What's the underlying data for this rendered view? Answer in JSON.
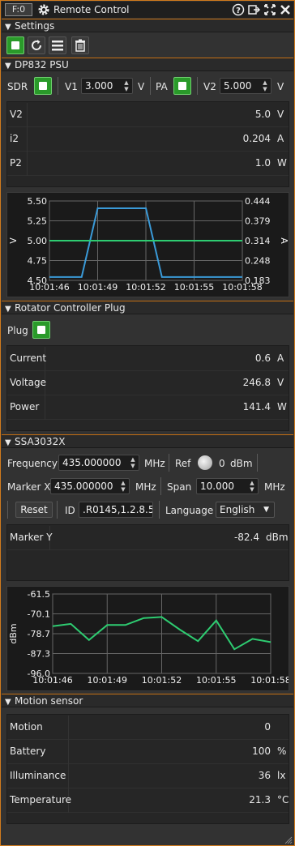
{
  "titlebar": {
    "badge": "F:0",
    "title": "Remote Control"
  },
  "settings": {
    "title": "Settings"
  },
  "dp832": {
    "title": "DP832 PSU",
    "sdr_label": "SDR",
    "v1_label": "V1",
    "v1_value": "3.000",
    "v1_unit": "V",
    "pa_label": "PA",
    "v2_label": "V2",
    "v2_value": "5.000",
    "v2_unit": "V",
    "rows": [
      {
        "name": "V2",
        "value": "5.0",
        "unit": "V"
      },
      {
        "name": "i2",
        "value": "0.204",
        "unit": "A"
      },
      {
        "name": "P2",
        "value": "1.0",
        "unit": "W"
      }
    ]
  },
  "rotator": {
    "title": "Rotator Controller Plug",
    "plug_label": "Plug",
    "rows": [
      {
        "name": "Current",
        "value": "0.6",
        "unit": "A"
      },
      {
        "name": "Voltage",
        "value": "246.8",
        "unit": "V"
      },
      {
        "name": "Power",
        "value": "141.4",
        "unit": "W"
      }
    ]
  },
  "ssa": {
    "title": "SSA3032X",
    "frequency_label": "Frequency",
    "frequency_value": "435.000000",
    "frequency_unit": "MHz",
    "ref_label": "Ref",
    "ref_value": "0",
    "ref_unit": "dBm",
    "markerx_label": "Marker X",
    "markerx_value": "435.000000",
    "markerx_unit": "MHz",
    "span_label": "Span",
    "span_value": "10.000",
    "span_unit": "MHz",
    "reset_label": "Reset",
    "id_label": "ID",
    "id_value": ".R0145,1.2.8.5a",
    "language_label": "Language",
    "language_value": "English",
    "rows": [
      {
        "name": "Marker Y",
        "value": "-82.4",
        "unit": "dBm"
      }
    ]
  },
  "motion": {
    "title": "Motion sensor",
    "rows": [
      {
        "name": "Motion",
        "value": "0",
        "unit": ""
      },
      {
        "name": "Battery",
        "value": "100",
        "unit": "%"
      },
      {
        "name": "Illuminance",
        "value": "36",
        "unit": "lx"
      },
      {
        "name": "Temperature",
        "value": "21.3",
        "unit": "°C"
      }
    ]
  },
  "colors": {
    "accent": "#d07a1c",
    "green_button": "#2a9a2a",
    "series_blue": "#3a9ad8",
    "series_green": "#2ecc71"
  },
  "chart_data": [
    {
      "type": "line",
      "title": "",
      "ylabel": "V",
      "y2label": "A",
      "ylim": [
        4.5,
        5.5
      ],
      "y2lim": [
        0.183,
        0.444
      ],
      "yticks": [
        "5.50",
        "5.25",
        "5.00",
        "4.75",
        "4.50"
      ],
      "y2ticks": [
        "0.444",
        "0.379",
        "0.314",
        "0.248",
        "0.183"
      ],
      "xticks": [
        "10:01:46",
        "10:01:49",
        "10:01:52",
        "10:01:55",
        "10:01:58"
      ],
      "xlim": [
        "10:01:46",
        "10:01:58"
      ],
      "grid": true,
      "series": [
        {
          "axis": "right",
          "color": "#3a9ad8",
          "x": [
            "10:01:46",
            "10:01:48",
            "10:01:49",
            "10:01:52",
            "10:01:53",
            "10:01:58"
          ],
          "y": [
            0.194,
            0.194,
            0.42,
            0.42,
            0.194,
            0.194
          ]
        },
        {
          "axis": "left",
          "color": "#2ecc71",
          "x": [
            "10:01:46",
            "10:01:52",
            "10:01:55",
            "10:01:58"
          ],
          "y": [
            5.0,
            5.0,
            5.0,
            5.0
          ]
        }
      ]
    },
    {
      "type": "line",
      "title": "",
      "ylabel": "dBm",
      "ylim": [
        -96.0,
        -61.5
      ],
      "yticks": [
        "-61.5",
        "-70.1",
        "-78.7",
        "-87.3",
        "-96.0"
      ],
      "xticks": [
        "10:01:46",
        "10:01:49",
        "10:01:52",
        "10:01:55",
        "10:01:58"
      ],
      "xlim": [
        "10:01:46",
        "10:01:58"
      ],
      "grid": true,
      "series": [
        {
          "color": "#2ecc71",
          "x": [
            "10:01:46",
            "10:01:47",
            "10:01:48",
            "10:01:49",
            "10:01:50",
            "10:01:51",
            "10:01:52",
            "10:01:53",
            "10:01:54",
            "10:01:55",
            "10:01:56",
            "10:01:57",
            "10:01:58"
          ],
          "y": [
            -75.5,
            -74.5,
            -81.5,
            -75.0,
            -75.0,
            -72.0,
            -71.5,
            -77.0,
            -82.0,
            -73.0,
            -85.5,
            -81.0,
            -82.4
          ]
        }
      ]
    }
  ]
}
